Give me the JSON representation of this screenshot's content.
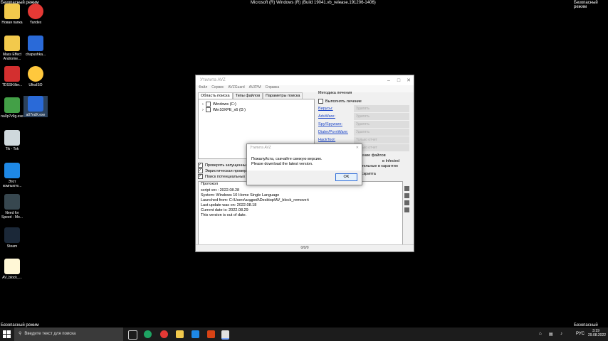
{
  "header": {
    "left_mode": "Безопасный режим",
    "center_build": "Microsoft (R) Windows (R) (Build 19041.vb_release.191206-1406)",
    "right_mode": "Безопасный режим"
  },
  "footer": {
    "left_mode": "Безопасный режим",
    "right_mode": "Безопасный режим"
  },
  "desktop_icons": [
    {
      "label": "Новая папка",
      "icon": "folder-icon"
    },
    {
      "label": "Yandex",
      "icon": "yandex-icon"
    },
    {
      "label": "Mass Effect Androme...",
      "icon": "folder-icon"
    },
    {
      "label": "chapushka...",
      "icon": "app-icon"
    },
    {
      "label": "TDSSKiller...",
      "icon": "kaspersky-icon"
    },
    {
      "label": "UltraISO",
      "icon": "disc-icon"
    },
    {
      "label": "na0p7v9g.exe",
      "icon": "shield-icon"
    },
    {
      "label": "a07ndX.exe",
      "icon": "app-icon"
    },
    {
      "label": "Tik - Tok",
      "icon": "recycle-bin-icon"
    },
    {
      "label": "Этот компьюте...",
      "icon": "computer-icon"
    },
    {
      "label": "Need for Speed - Mo...",
      "icon": "game-icon"
    },
    {
      "label": "Steam",
      "icon": "steam-icon"
    },
    {
      "label": "AV_block_...",
      "icon": "file-icon"
    }
  ],
  "window": {
    "title": "Утилита AVZ",
    "menu": [
      "Файл",
      "Сервис",
      "AVZGuard",
      "AVZPM",
      "Справка"
    ],
    "tabs": [
      "Область поиска",
      "Типы файлов",
      "Параметры поиска"
    ],
    "tree": [
      "Windows (C:)",
      "Win10XPE_x6 (D:)"
    ],
    "treatment": {
      "heading": "Методика лечения",
      "do_treatment": "Выполнять лечение",
      "rows": [
        {
          "label": "Вирусы:",
          "action": "Удалять"
        },
        {
          "label": "AdvWare:",
          "action": "Удалять"
        },
        {
          "label": "Spy/Spyware:",
          "action": "Удалять"
        },
        {
          "label": "Dialer/PornWare:",
          "action": "Удалять"
        },
        {
          "label": "HackTool:",
          "action": "Только отчет"
        },
        {
          "label": "",
          "action": "Только отчет"
        }
      ],
      "partial1": "ение файлов",
      "partial2": "в Infected",
      "partial3": "тельные в карантин",
      "partial4": "скрипта"
    },
    "checks": [
      "Проверять запущенные",
      "Эвристическая провер",
      "Поиск потенциальных у"
    ],
    "protocol_label": "Протокол",
    "protocol_lines": [
      "script ver.: 2022.08.28",
      "System: Windows 10 Home Single Language",
      "Launched from: C:\\Users\\андрей\\Desktop\\AV_block_remover\\",
      "Last update was on: 2022.08.18",
      "Current date is: 2022.08.29",
      "This version is out of date."
    ],
    "status": "0/0/0"
  },
  "dialog": {
    "title": "Утилита AVZ",
    "line1": "Пожалуйста, скачайте свежую версию.",
    "line2": "Please download the latest version.",
    "ok": "OK"
  },
  "taskbar": {
    "search_placeholder": "Введите текст для поиска",
    "lang": "РУС",
    "time": "3:19",
    "date": "29.08.2022"
  },
  "colors": {
    "link": "#1a44c8",
    "taskbar": "#1c1c1c",
    "accent": "#2a6ad8"
  }
}
